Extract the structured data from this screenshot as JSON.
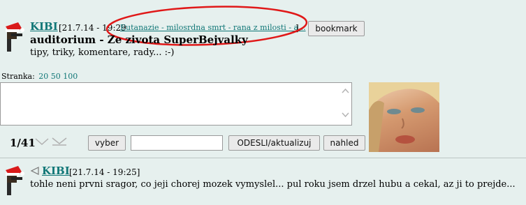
{
  "header": {
    "username": "KIBI",
    "timestamp": "[21.7.14 - 19:29",
    "last_link": "Eutanazie - milosrdna smrt - rana z milosti - a...",
    "bracket_close": "]",
    "bookmark_label": "bookmark"
  },
  "auditorium": {
    "title": "auditorium - Ze zivota SuperBejvalky",
    "subtitle": "tipy, triky, komentare, rady... :-)"
  },
  "paging": {
    "label": "Stranka:",
    "options": [
      "20",
      "50",
      "100"
    ]
  },
  "controls": {
    "page_indicator": "1/41",
    "vyber_label": "vyber",
    "filter_value": "",
    "send_label": "ODESLI/aktualizuj",
    "preview_label": "nahled"
  },
  "post": {
    "username": "KIBI",
    "timestamp": "[21.7.14 - 19:25]",
    "text": "tohle neni prvni sragor, co jeji chorej mozek vymyslel... pul roku jsem drzel hubu a cekal, az ji to prejde..."
  },
  "colors": {
    "background": "#e6f0ee",
    "link": "#117777",
    "annotation_circle": "#e01818"
  },
  "icons": [
    "santa-gun-avatar-icon",
    "scroll-up-icon",
    "scroll-down-icon",
    "arrow-down-icon",
    "arrow-down-double-icon",
    "reply-arrow-icon"
  ]
}
